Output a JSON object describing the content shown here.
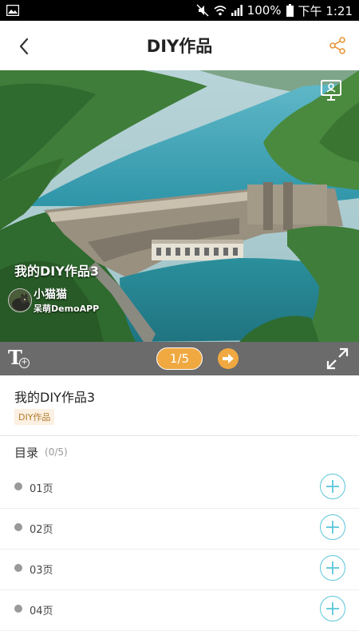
{
  "status_bar": {
    "battery_percent": "100%",
    "time": "下午 1:21",
    "icons": [
      "image-icon",
      "mute-icon",
      "wifi-icon",
      "signal-icon",
      "battery-icon"
    ]
  },
  "header": {
    "title": "DIY作品",
    "icons": {
      "back": "back-arrow-icon",
      "share": "share-icon"
    },
    "accent_color": "#e8963a"
  },
  "hero": {
    "work_title": "我的DIY作品3",
    "author_name": "小猫猫",
    "author_app": "呆萌DemoAPP",
    "icons": {
      "present": "presentation-icon"
    }
  },
  "controls": {
    "page_indicator": "1/5",
    "icons": {
      "text": "add-text-icon",
      "next": "next-arrow-icon",
      "fullscreen": "fullscreen-icon"
    },
    "bar_color": "#6b6b6b",
    "pill_color": "#f0a840"
  },
  "info": {
    "name": "我的DIY作品3",
    "tag": "DIY作品"
  },
  "toc": {
    "label": "目录",
    "count": "(0/5)",
    "items": [
      {
        "label": "01页"
      },
      {
        "label": "02页"
      },
      {
        "label": "03页"
      },
      {
        "label": "04页"
      }
    ],
    "add_color": "#5bc6da"
  }
}
